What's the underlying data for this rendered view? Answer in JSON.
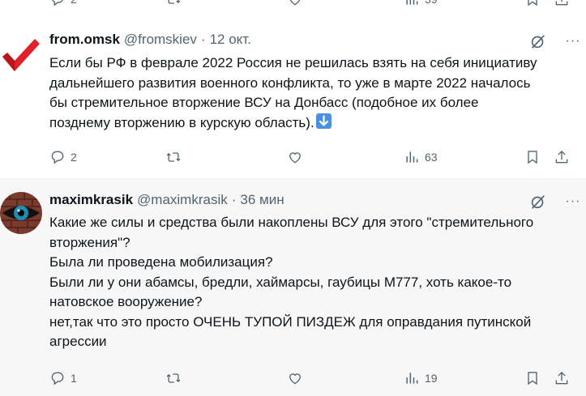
{
  "prev_post": {
    "reply_count": "2",
    "views_count": "59"
  },
  "post1": {
    "display_name": "from.omsk",
    "handle": "@fromskiev",
    "separator": "·",
    "time": "12 окт.",
    "text_lines": [
      "Если бы РФ в феврале 2022 Россия не решилась взять на себя инициативу",
      "дальнейшего развития военного конфликта, то уже в марте 2022 началось",
      "бы стремительное вторжение ВСУ на Донбасс (подобное их более",
      "позднему вторжению в курскую область)."
    ],
    "emoji": "down-arrow-emoji",
    "avatar": "red-checkmark",
    "reply_count": "2",
    "repost_count": "",
    "like_count": "",
    "views_count": "63"
  },
  "post2": {
    "display_name": "maximkrasik",
    "handle": "@maximkrasik",
    "separator": "·",
    "time": "36 мин",
    "text_lines": [
      "Какие же силы и средства были накоплены ВСУ для этого \"стремительного",
      "вторжения\"?",
      "Была ли проведена мобилизация?",
      "Были ли у они абамсы, бредли, хаймарсы, гаубицы М777,  хоть какое-то",
      "натовское вооружение?",
      "нет,так что это просто ОЧЕНЬ ТУПОЙ ПИЗДЕЖ для оправдания путинской",
      "агрессии"
    ],
    "avatar": "eye-on-brick-wall",
    "reply_count": "1",
    "repost_count": "",
    "like_count": "",
    "views_count": "19"
  },
  "icons": {
    "reply": "reply-icon",
    "repost": "repost-icon",
    "like": "like-icon",
    "views": "views-icon",
    "bookmark": "bookmark-icon",
    "share": "share-icon",
    "grok": "grok-icon",
    "more": "more-icon"
  },
  "colors": {
    "text_primary": "#0f1419",
    "text_secondary": "#536471",
    "selected_bg": "#f7f7f7",
    "checkmark_red": "#e0202a"
  }
}
